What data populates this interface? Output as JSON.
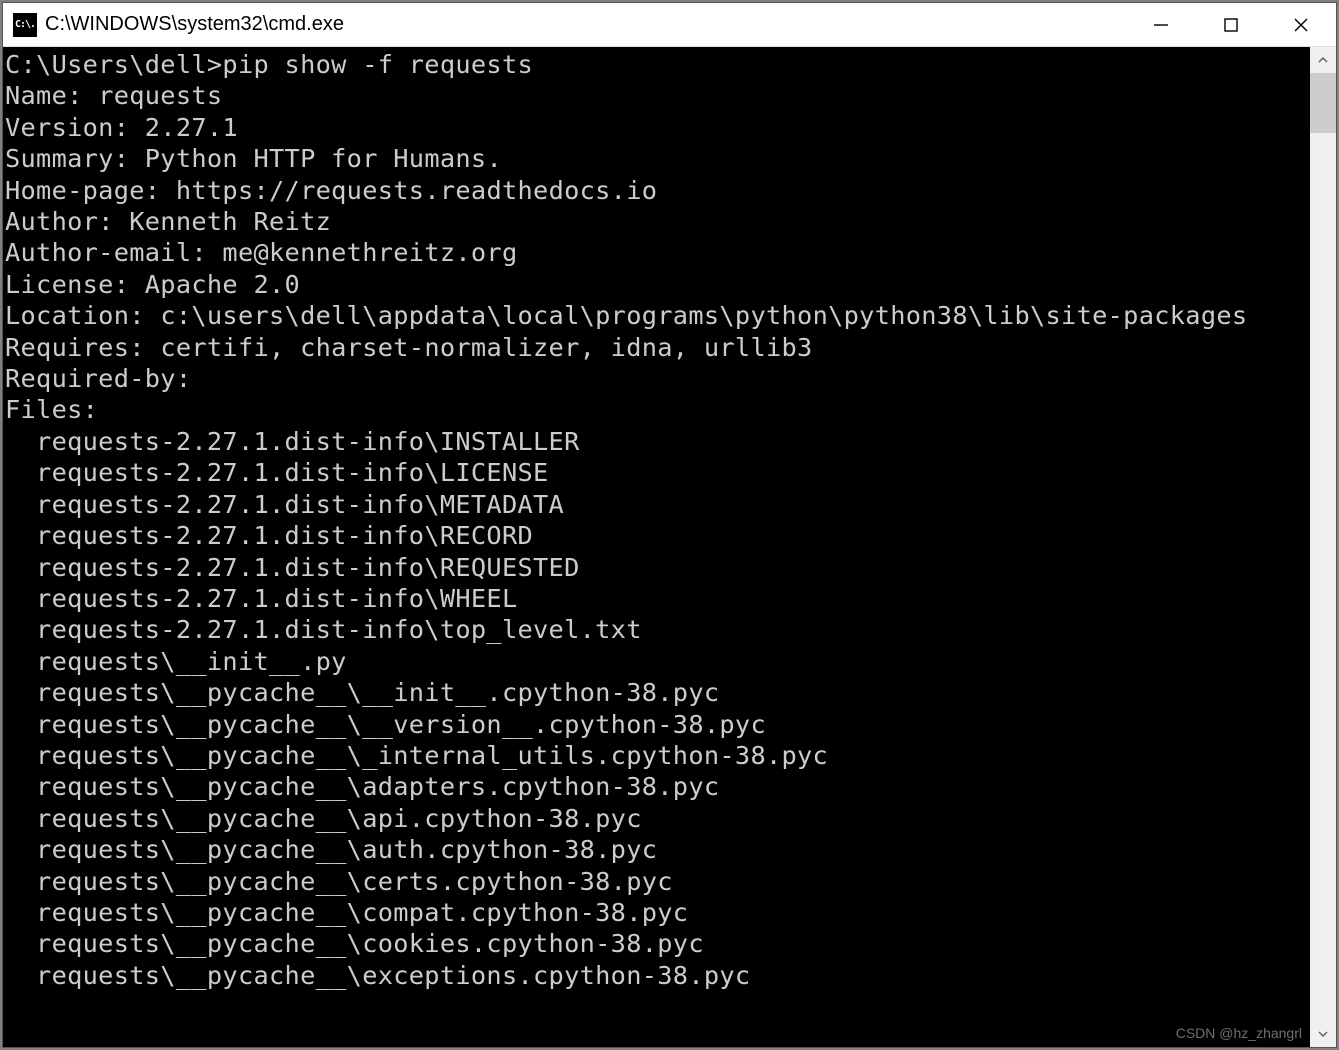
{
  "window": {
    "title": "C:\\WINDOWS\\system32\\cmd.exe",
    "icon_text": "C:\\."
  },
  "terminal": {
    "prompt": "C:\\Users\\dell>",
    "command": "pip show -f requests",
    "fields": {
      "name_label": "Name: ",
      "name_value": "requests",
      "version_label": "Version: ",
      "version_value": "2.27.1",
      "summary_label": "Summary: ",
      "summary_value": "Python HTTP for Humans.",
      "homepage_label": "Home-page: ",
      "homepage_value": "https://requests.readthedocs.io",
      "author_label": "Author: ",
      "author_value": "Kenneth Reitz",
      "authoremail_label": "Author-email: ",
      "authoremail_value": "me@kennethreitz.org",
      "license_label": "License: ",
      "license_value": "Apache 2.0",
      "location_label": "Location: ",
      "location_value": "c:\\users\\dell\\appdata\\local\\programs\\python\\python38\\lib\\site-packages",
      "requires_label": "Requires: ",
      "requires_value": "certifi, charset-normalizer, idna, urllib3",
      "requiredby_label": "Required-by:",
      "requiredby_value": "",
      "files_label": "Files:"
    },
    "files": [
      "requests-2.27.1.dist-info\\INSTALLER",
      "requests-2.27.1.dist-info\\LICENSE",
      "requests-2.27.1.dist-info\\METADATA",
      "requests-2.27.1.dist-info\\RECORD",
      "requests-2.27.1.dist-info\\REQUESTED",
      "requests-2.27.1.dist-info\\WHEEL",
      "requests-2.27.1.dist-info\\top_level.txt",
      "requests\\__init__.py",
      "requests\\__pycache__\\__init__.cpython-38.pyc",
      "requests\\__pycache__\\__version__.cpython-38.pyc",
      "requests\\__pycache__\\_internal_utils.cpython-38.pyc",
      "requests\\__pycache__\\adapters.cpython-38.pyc",
      "requests\\__pycache__\\api.cpython-38.pyc",
      "requests\\__pycache__\\auth.cpython-38.pyc",
      "requests\\__pycache__\\certs.cpython-38.pyc",
      "requests\\__pycache__\\compat.cpython-38.pyc",
      "requests\\__pycache__\\cookies.cpython-38.pyc",
      "requests\\__pycache__\\exceptions.cpython-38.pyc"
    ]
  },
  "watermark": "CSDN @hz_zhangrl"
}
